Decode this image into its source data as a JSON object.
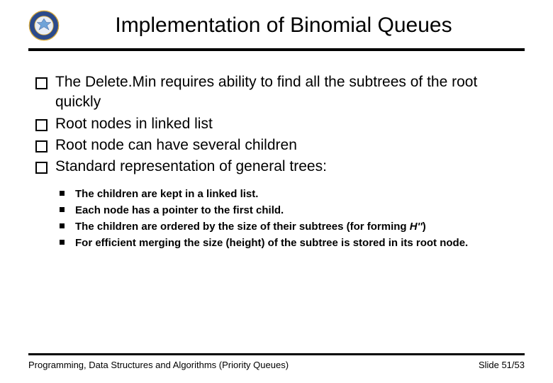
{
  "title": "Implementation of Binomial Queues",
  "bullets": {
    "b0": "The Delete.Min requires ability to find all the subtrees of the root quickly",
    "b1": "Root nodes in linked list",
    "b2": "Root node can have several children",
    "b3": "Standard representation of general trees:"
  },
  "sub": {
    "s0": "The children are kept in a linked list.",
    "s1": "Each node has a pointer to the first child.",
    "s2_a": "The children are ordered by the size of their subtrees (for forming ",
    "s2_b": "H''",
    "s2_c": ")",
    "s3": "For efficient merging the size (height) of the subtree is stored in its root node."
  },
  "footer": {
    "left": "Programming, Data Structures and Algorithms (Priority Queues)",
    "right": "Slide 51/53"
  }
}
